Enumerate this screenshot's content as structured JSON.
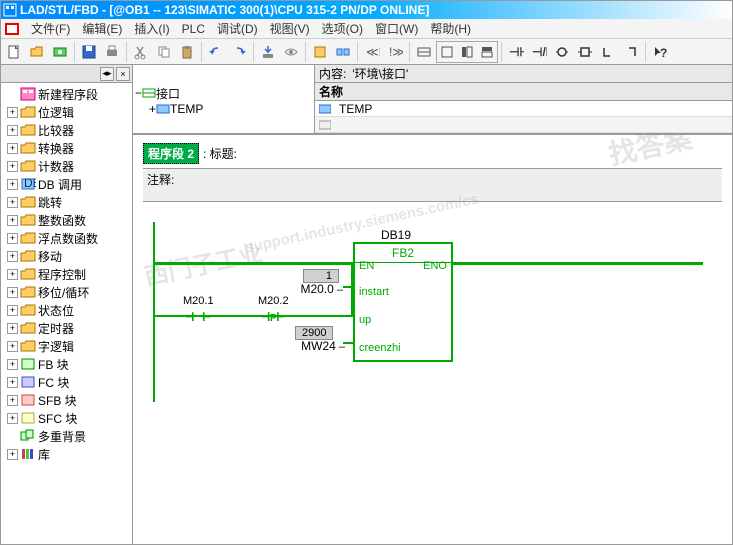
{
  "title": "LAD/STL/FBD  - [@OB1 -- 123\\SIMATIC 300(1)\\CPU 315-2 PN/DP  ONLINE]",
  "menu": {
    "file": "文件(F)",
    "edit": "编辑(E)",
    "insert": "插入(I)",
    "plc": "PLC",
    "debug": "调试(D)",
    "view": "视图(V)",
    "options": "选项(O)",
    "window": "窗口(W)",
    "help": "帮助(H)"
  },
  "sb_toggle": "◂▸",
  "tree": [
    {
      "exp": "",
      "ico": "new",
      "lbl": "新建程序段"
    },
    {
      "exp": "+",
      "ico": "fld",
      "lbl": "位逻辑"
    },
    {
      "exp": "+",
      "ico": "fld",
      "lbl": "比较器"
    },
    {
      "exp": "+",
      "ico": "fld",
      "lbl": "转换器"
    },
    {
      "exp": "+",
      "ico": "fld",
      "lbl": "计数器"
    },
    {
      "exp": "+",
      "ico": "db",
      "lbl": "DB 调用"
    },
    {
      "exp": "+",
      "ico": "fld",
      "lbl": "跳转"
    },
    {
      "exp": "+",
      "ico": "fld",
      "lbl": "整数函数"
    },
    {
      "exp": "+",
      "ico": "fld",
      "lbl": "浮点数函数"
    },
    {
      "exp": "+",
      "ico": "fld",
      "lbl": "移动"
    },
    {
      "exp": "+",
      "ico": "fld",
      "lbl": "程序控制"
    },
    {
      "exp": "+",
      "ico": "fld",
      "lbl": "移位/循环"
    },
    {
      "exp": "+",
      "ico": "fld",
      "lbl": "状态位"
    },
    {
      "exp": "+",
      "ico": "fld",
      "lbl": "定时器"
    },
    {
      "exp": "+",
      "ico": "fld",
      "lbl": "字逻辑"
    },
    {
      "exp": "+",
      "ico": "fb",
      "lbl": "FB 块"
    },
    {
      "exp": "+",
      "ico": "fc",
      "lbl": "FC 块"
    },
    {
      "exp": "+",
      "ico": "sfb",
      "lbl": "SFB 块"
    },
    {
      "exp": "+",
      "ico": "sfc",
      "lbl": "SFC 块"
    },
    {
      "exp": "",
      "ico": "multi",
      "lbl": "多重背景"
    },
    {
      "exp": "+",
      "ico": "lib",
      "lbl": "库"
    }
  ],
  "iface": {
    "content_lbl": "内容:",
    "content_val": "'环境\\接口'",
    "root": "接口",
    "temp": "TEMP",
    "name_hdr": "名称",
    "row": "TEMP"
  },
  "seg": {
    "tag": "程序段 2",
    "title": ": 标题:",
    "comment_lbl": "注释:"
  },
  "fb": {
    "db": "DB19",
    "name": "FB2",
    "en": "EN",
    "eno": "ENO",
    "p1": "instart",
    "p2": "up",
    "p3": "creenzhi",
    "addr1": "M20.0",
    "addr2": "M20.2",
    "addr3": "MW24",
    "val1": "1",
    "val3": "2900",
    "contact": "M20.1",
    "pulse": "P"
  },
  "wm1": "找答案",
  "wm2": "西门子工业",
  "wm3": "support.industry.siemens.com/cs"
}
